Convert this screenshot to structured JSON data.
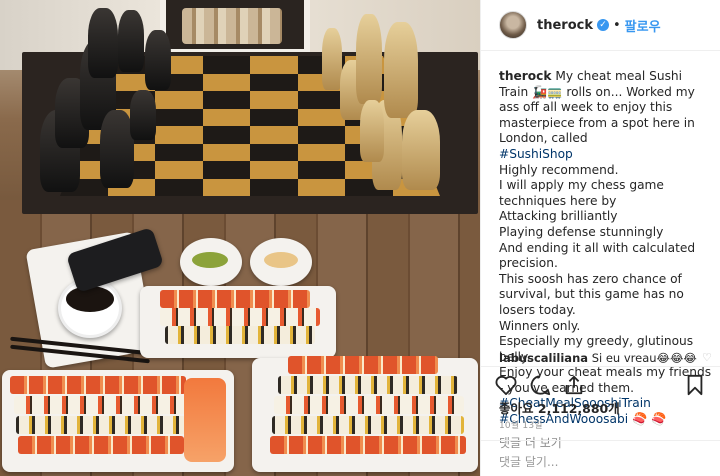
{
  "post": {
    "username": "therock",
    "follow_label": "팔로우",
    "caption_lines": [
      "My cheat meal Sushi Train 🚂🚃 rolls on... Worked my ass off all week to enjoy this masterpiece from a spot here in London, called",
      "#SushiShop",
      "Highly recommend.",
      "I will apply my chess game techniques here by",
      "Attacking brilliantly",
      "Playing defense stunningly",
      "And ending it all with calculated precision.",
      "This soosh has zero chance of survival, but this game has no losers today.",
      "Winners only.",
      "Especially my greedy, glutinous belly.",
      "Enjoy your cheat meals my friends - you've earned them.",
      "#CheatMealSoooshiTrain",
      "#ChessAndWooosabi 🍣 🍣"
    ],
    "view_more_label": "댓글 더 보기",
    "comment": {
      "username": "labuscaliliana",
      "text": "Si eu vreau😂😂😂"
    },
    "likes_label": "좋아요",
    "likes_count": "2,112,880개",
    "date": "10월 13일",
    "add_comment_placeholder": "댓글 달기..."
  },
  "icons": {
    "verified": "verified-badge-icon",
    "like": "heart-icon",
    "comment": "comment-icon",
    "share": "share-icon",
    "save": "bookmark-icon"
  },
  "colors": {
    "accent": "#3897f0",
    "hashtag": "#003569",
    "muted": "#8e8e8e"
  }
}
